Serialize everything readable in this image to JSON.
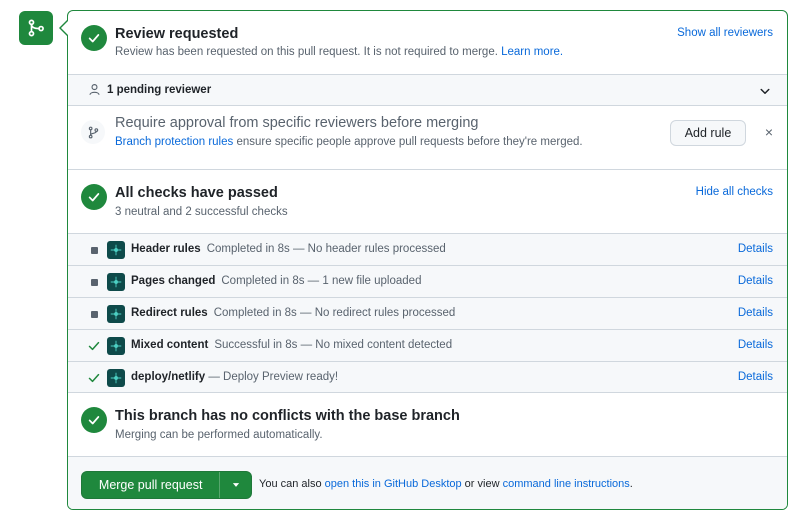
{
  "review": {
    "title": "Review requested",
    "subtitle": "Review has been requested on this pull request. It is not required to merge.",
    "learn_more": "Learn more.",
    "show_all": "Show all reviewers",
    "pending": "1 pending reviewer"
  },
  "require_approval": {
    "title": "Require approval from specific reviewers before merging",
    "link": "Branch protection rules",
    "text": " ensure specific people approve pull requests before they're merged.",
    "add_rule": "Add rule",
    "close": "×"
  },
  "checks": {
    "title": "All checks have passed",
    "subtitle": "3 neutral and 2 successful checks",
    "hide_all": "Hide all checks",
    "rows": [
      {
        "name": "Header rules",
        "desc": "Completed in 8s — No header rules processed",
        "status": "neutral",
        "details": "Details"
      },
      {
        "name": "Pages changed",
        "desc": "Completed in 8s — 1 new file uploaded",
        "status": "neutral",
        "details": "Details"
      },
      {
        "name": "Redirect rules",
        "desc": "Completed in 8s — No redirect rules processed",
        "status": "neutral",
        "details": "Details"
      },
      {
        "name": "Mixed content",
        "desc": "Successful in 8s — No mixed content detected",
        "status": "success",
        "details": "Details"
      },
      {
        "name": "deploy/netlify",
        "desc": " — Deploy Preview ready!",
        "status": "success",
        "details": "Details"
      }
    ]
  },
  "conflicts": {
    "title": "This branch has no conflicts with the base branch",
    "subtitle": "Merging can be performed automatically."
  },
  "merge": {
    "button": "Merge pull request",
    "text_prefix": "You can also ",
    "desktop_link": "open this in GitHub Desktop",
    "text_middle": " or view ",
    "cli_link": "command line instructions",
    "text_suffix": "."
  },
  "colors": {
    "success": "#1f883d",
    "link": "#0969da",
    "muted": "#59636e",
    "border": "#d0d7de",
    "subtle_bg": "#f6f8fa"
  }
}
